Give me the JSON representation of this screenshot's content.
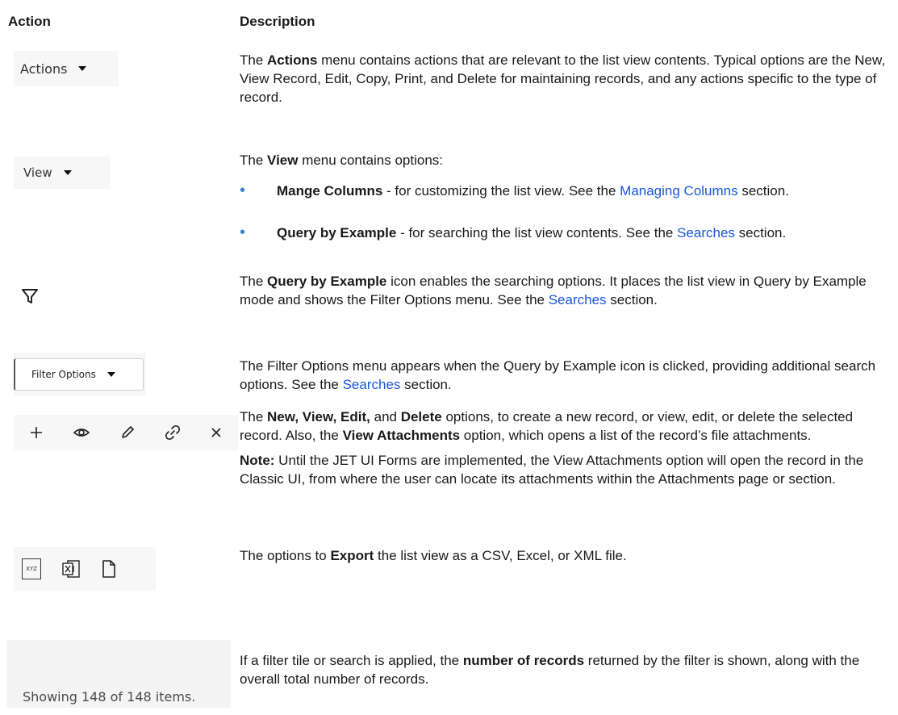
{
  "headers": {
    "action": "Action",
    "description": "Description"
  },
  "rows": {
    "actions": {
      "button_label": "Actions",
      "d1": "The ",
      "b1": "Actions",
      "d2": " menu contains actions that are relevant to the list view contents. Typical options are the New, View Record, Edit, Copy, Print, and Delete for maintaining records, and any actions specific to the type of record."
    },
    "view": {
      "button_label": "View",
      "d1": "The ",
      "b1": "View",
      "d2": " menu contains options:",
      "bullet1_bold": "Mange Columns",
      "bullet1_text": " - for customizing the list view. See the ",
      "bullet1_link": "Managing Columns",
      "bullet1_tail": " section.",
      "bullet2_bold": "Query by Example",
      "bullet2_text": " - for searching the list view contents. See the ",
      "bullet2_link": "Searches",
      "bullet2_tail": " section."
    },
    "qbe": {
      "icon": "filter-funnel-icon",
      "d1": "The ",
      "b1": "Query by Example",
      "d2": " icon enables the searching options. It places the list view in Query by Example mode and shows the Filter Options menu. See the ",
      "link": "Searches",
      "tail": " section."
    },
    "filter": {
      "button_label": "Filter Options",
      "d1": "The Filter Options menu appears when the Query by Example icon is clicked, providing additional search options. See the ",
      "link": "Searches",
      "tail": " section."
    },
    "nved": {
      "icons": [
        "plus-icon",
        "eye-icon",
        "pencil-icon",
        "link-icon",
        "close-icon"
      ],
      "d1": "The ",
      "b1": "New, View, Edit,",
      "d2": " and ",
      "b2": "Delete",
      "d3": " options, to create a new record, or view, edit, or delete the selected record. Also, the ",
      "b3": "View Attachments",
      "d4": " option, which opens a list of the record’s file attachments.",
      "note_label": "Note:",
      "note_text": " Until the JET UI Forms are implemented, the View Attachments option will open the record in the Classic UI, from where the user can locate its attachments within the Attachments page or section."
    },
    "export": {
      "icons": [
        "csv-file-icon",
        "excel-file-icon",
        "xml-file-icon"
      ],
      "csv_badge": "XYZ",
      "d1": "The options to ",
      "b1": "Export",
      "d2": " the list view as a CSV, Excel, or XML file."
    },
    "count": {
      "status_text": "Showing 148 of 148 items.",
      "d1": "If a filter tile or search is applied, the ",
      "b1": "number of records",
      "d2": " returned by the filter is shown, along with the overall total number of records."
    }
  }
}
